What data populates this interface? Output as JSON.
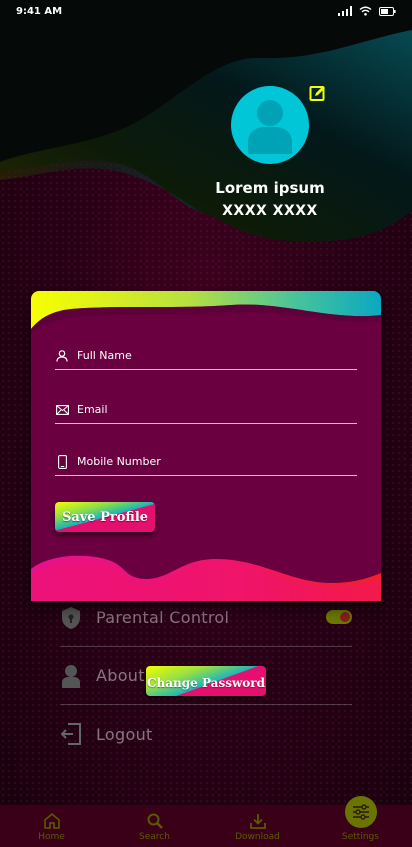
{
  "status_bar": {
    "time": "9:41 AM"
  },
  "profile": {
    "name": "Lorem ipsum",
    "id": "XXXX XXXX"
  },
  "form": {
    "full_name_placeholder": "Full Name",
    "email_placeholder": "Email",
    "mobile_placeholder": "Mobile Number",
    "save_label": "Save Profile"
  },
  "menu": {
    "parental_control": "Parental Control",
    "parental_control_enabled": true,
    "about": "About",
    "logout": "Logout",
    "change_password_label": "Change Password"
  },
  "nav": {
    "home": "Home",
    "search": "Search",
    "download": "Download",
    "settings": "Settings",
    "active": "Settings"
  },
  "colors": {
    "avatar": "#00c6d8",
    "card": "#6a0040",
    "accent_yellow": "#f2ff00",
    "accent_teal": "#16b4bc",
    "accent_pink": "#e40f6e"
  }
}
